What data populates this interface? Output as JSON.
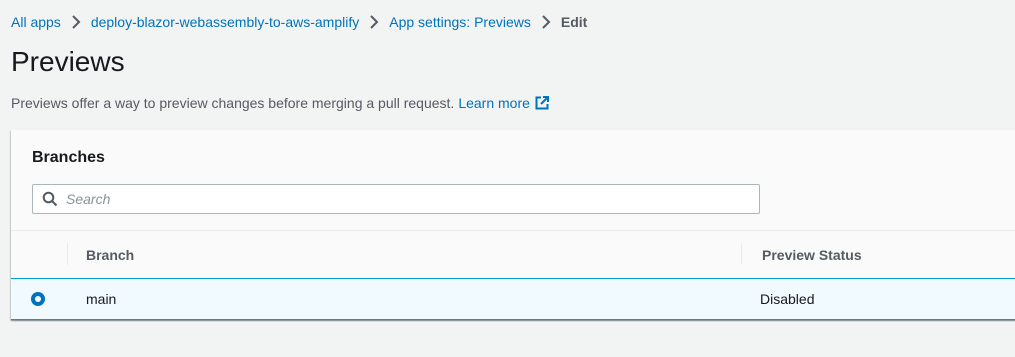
{
  "breadcrumb": {
    "items": [
      {
        "label": "All apps"
      },
      {
        "label": "deploy-blazor-webassembly-to-aws-amplify"
      },
      {
        "label": "App settings: Previews"
      }
    ],
    "current": "Edit"
  },
  "page": {
    "title": "Previews",
    "description": "Previews offer a way to preview changes before merging a pull request.",
    "learn_more": "Learn more"
  },
  "branches": {
    "title": "Branches",
    "search": {
      "placeholder": "Search",
      "value": ""
    },
    "columns": [
      "Branch",
      "Preview Status"
    ],
    "rows": [
      {
        "branch": "main",
        "status": "Disabled",
        "selected": true
      }
    ]
  },
  "colors": {
    "link": "#0073bb",
    "selected_row_bg": "#f1faff",
    "selected_row_border": "#00a1c9",
    "page_bg": "#f2f3f3"
  }
}
